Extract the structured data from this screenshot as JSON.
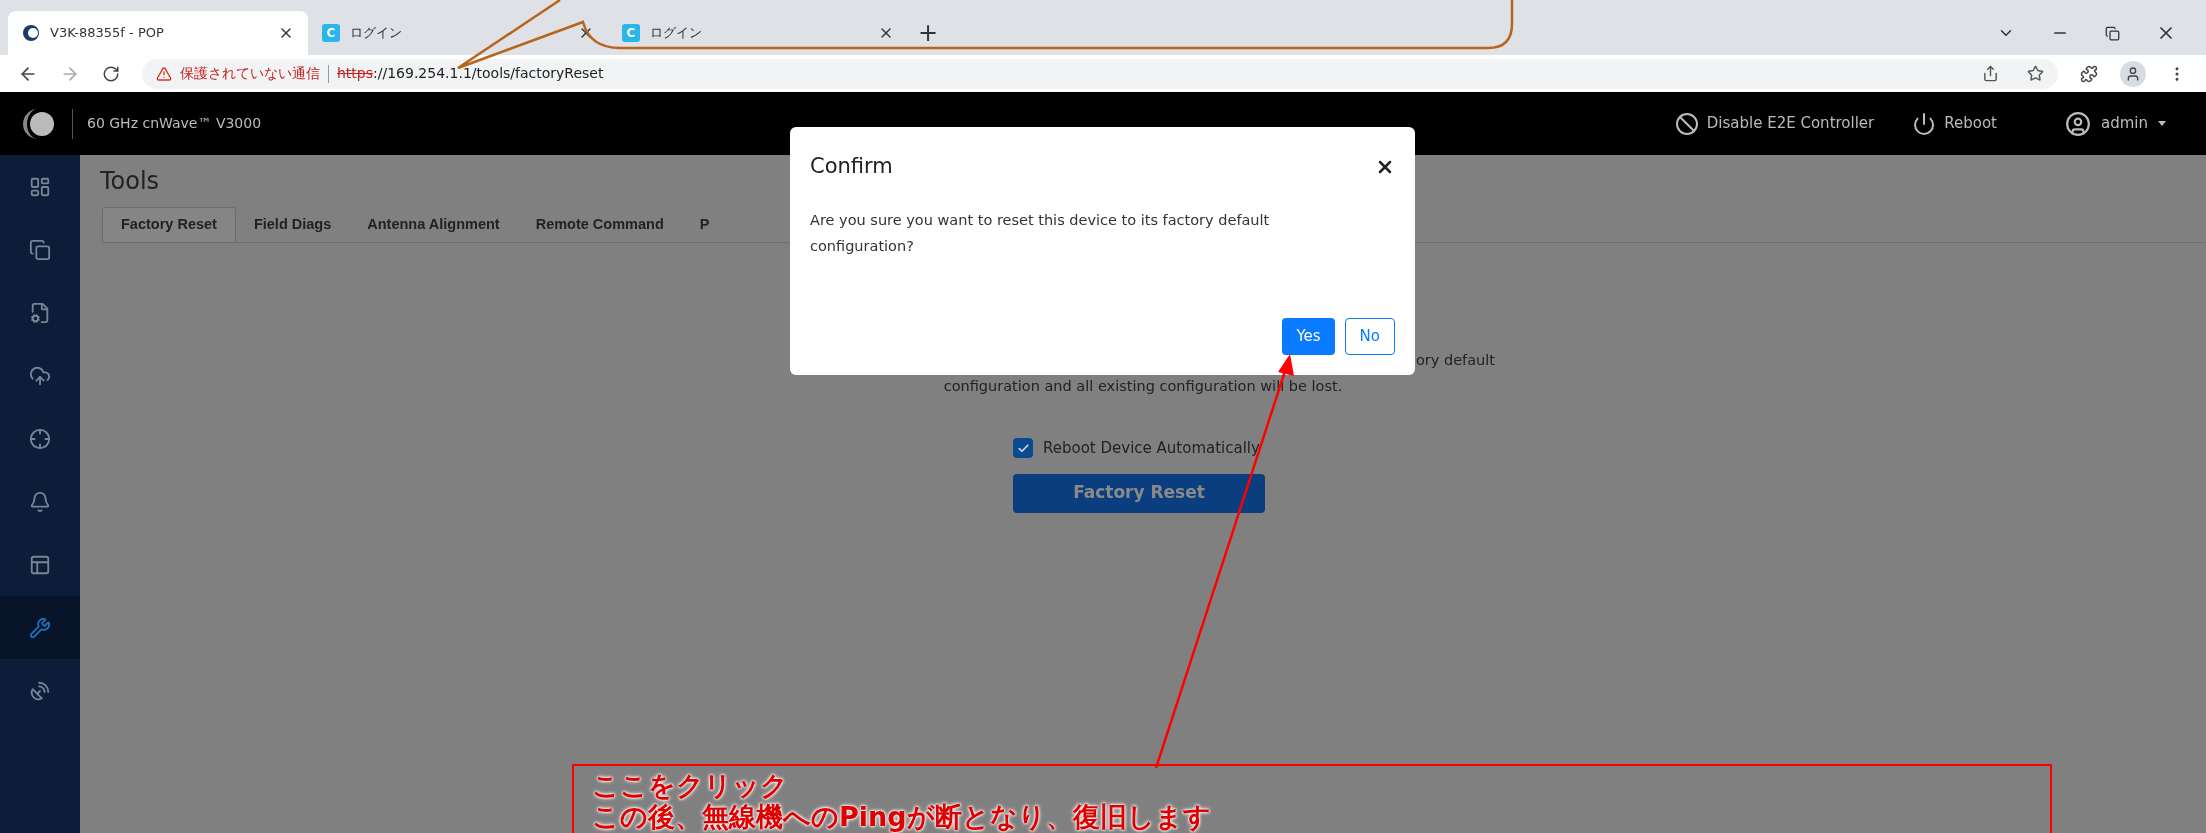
{
  "browser": {
    "tabs": [
      {
        "title": "V3K-88355f - POP",
        "selected": true,
        "kind": "cambium"
      },
      {
        "title": "ログイン",
        "selected": false,
        "kind": "letter",
        "letter": "C"
      },
      {
        "title": "ログイン",
        "selected": false,
        "kind": "letter",
        "letter": "C"
      }
    ],
    "new_tab": "+",
    "security_warning": "保護されていない通信",
    "url_scheme": "https",
    "url_rest": "://169.254.1.1/tools/factoryReset"
  },
  "header": {
    "product": "60 GHz cnWave™ V3000",
    "actions": [
      {
        "label": "Disable E2E Controller",
        "kind": "disable"
      },
      {
        "label": "Reboot",
        "kind": "power"
      }
    ],
    "user": "admin"
  },
  "sidebar": [
    {
      "kind": "dashboard",
      "selected": false
    },
    {
      "kind": "copy",
      "selected": false
    },
    {
      "kind": "file",
      "selected": false
    },
    {
      "kind": "cloud",
      "selected": false
    },
    {
      "kind": "crosshair",
      "selected": false
    },
    {
      "kind": "bell",
      "selected": false
    },
    {
      "kind": "layout",
      "selected": false
    },
    {
      "kind": "tools",
      "selected": true
    },
    {
      "kind": "dish",
      "selected": false
    }
  ],
  "page": {
    "title": "Tools",
    "tabs": [
      {
        "label": "Factory Reset",
        "selected": true
      },
      {
        "label": "Field Diags",
        "selected": false
      },
      {
        "label": "Antenna Alignment",
        "selected": false
      },
      {
        "label": "Remote Command",
        "selected": false
      },
      {
        "label": "P",
        "selected": false
      }
    ],
    "description_line_1": "ory default",
    "description_line_2": "configuration and all existing configuration will be lost.",
    "reboot_checkbox": {
      "label": "Reboot Device Automatically",
      "checked": true
    },
    "factory_reset_button": "Factory Reset"
  },
  "dialog": {
    "title": "Confirm",
    "message": "Are you sure you want to reset this device to its factory default configuration?",
    "buttons": [
      {
        "label": "Yes",
        "kind": "primary"
      },
      {
        "label": "No",
        "kind": "outline"
      }
    ]
  },
  "annotation": {
    "lines": [
      "ここをクリック",
      "この後、無線機へのPingが断となり、復旧します"
    ]
  }
}
